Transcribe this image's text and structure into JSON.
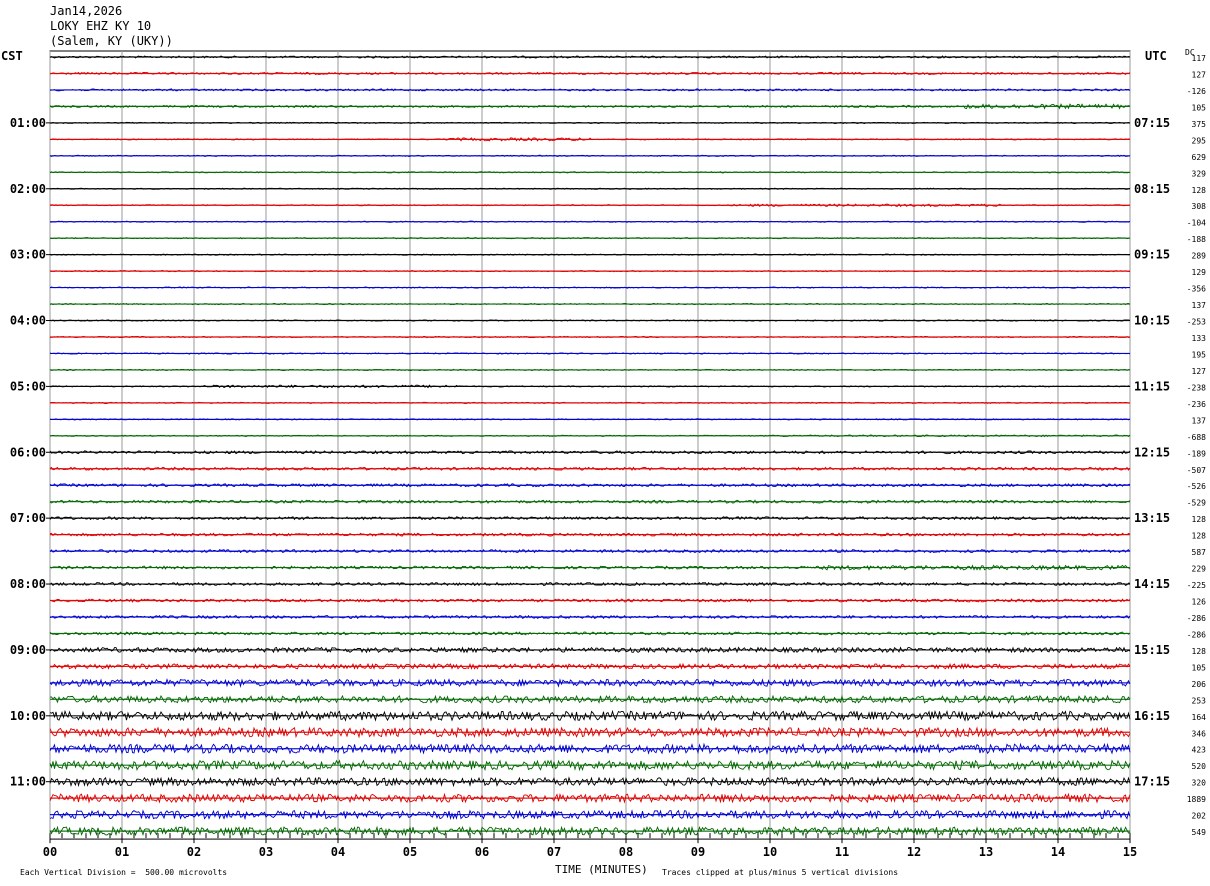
{
  "header": {
    "date": "Jan14,2026",
    "station": "LOKY EHZ KY 10",
    "location": "(Salem, KY (UKY))"
  },
  "chart_data": {
    "type": "line",
    "title": "LOKY EHZ KY 10",
    "left_axis_label": "CST",
    "right_axis_label": "UTC",
    "dc_label": "DC",
    "xlabel": "TIME (MINUTES)",
    "x_ticks": [
      "00",
      "01",
      "02",
      "03",
      "04",
      "05",
      "06",
      "07",
      "08",
      "09",
      "10",
      "11",
      "12",
      "13",
      "14",
      "15"
    ],
    "xlim": [
      0,
      15
    ],
    "left_hour_labels": [
      "01:00",
      "02:00",
      "03:00",
      "04:00",
      "05:00",
      "06:00",
      "07:00",
      "08:00",
      "09:00",
      "10:00",
      "11:00"
    ],
    "right_hour_labels": [
      "07:15",
      "08:15",
      "09:15",
      "10:15",
      "11:15",
      "12:15",
      "13:15",
      "14:15",
      "15:15",
      "16:15",
      "17:15"
    ],
    "trace_colors": [
      "#000000",
      "#dd0000",
      "#0000cc",
      "#006600"
    ],
    "dc_offsets": [
      "117",
      "127",
      "-126",
      "105",
      "375",
      "295",
      "629",
      "329",
      "128",
      "308",
      "-104",
      "-188",
      "289",
      "129",
      "-356",
      "137",
      "-253",
      "133",
      "195",
      "127",
      "-238",
      "-236",
      "137",
      "-688",
      "-189",
      "-507",
      "-526",
      "-529",
      "128",
      "128",
      "587",
      "229",
      "-225",
      "126",
      "-286",
      "-286",
      "128",
      "105",
      "206",
      "253",
      "164",
      "346",
      "423",
      "520",
      "320",
      "1889",
      "202",
      "549"
    ],
    "footer": {
      "scale_note": "Each Vertical Division =  500.00 microvolts",
      "clip_note": "Traces clipped at plus/minus 5 vertical divisions"
    }
  }
}
